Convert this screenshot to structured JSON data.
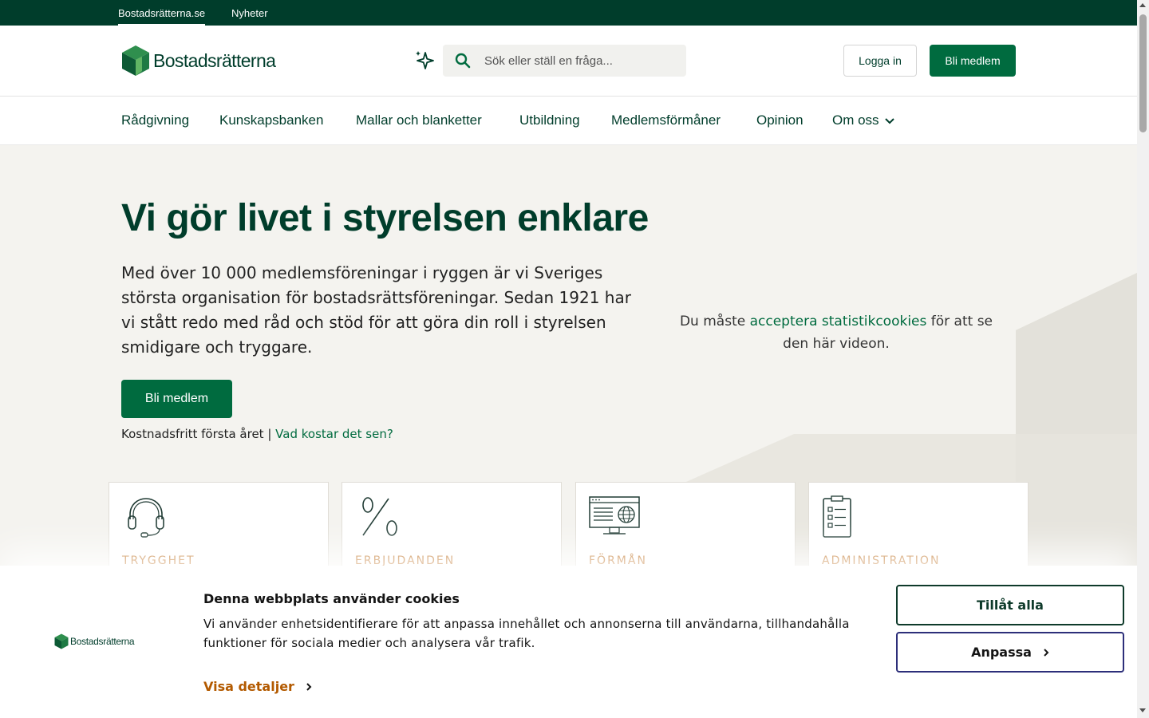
{
  "topbar": {
    "tabs": [
      {
        "label": "Bostadsrätterna.se"
      },
      {
        "label": "Nyheter"
      }
    ]
  },
  "header": {
    "logo_text": "Bostadsrätterna",
    "search_placeholder": "Sök eller ställ en fråga...",
    "login_label": "Logga in",
    "member_label": "Bli medlem"
  },
  "nav": {
    "items": [
      {
        "label": "Rådgivning"
      },
      {
        "label": "Kunskapsbanken"
      },
      {
        "label": "Mallar och blanketter"
      },
      {
        "label": "Utbildning"
      },
      {
        "label": "Medlemsförmåner"
      },
      {
        "label": "Opinion"
      },
      {
        "label": "Om oss"
      }
    ]
  },
  "hero": {
    "title": "Vi gör livet i styrelsen enklare",
    "lead": "Med över 10 000 medlemsföreningar i ryggen är vi Sveriges största organisation för bostadsrättsföreningar. Sedan 1921 har vi stått redo med råd och stöd för att göra din roll i styrelsen smidigare och tryggare.",
    "cta_label": "Bli medlem",
    "sub_text": "Kostnadsfritt första året |",
    "sub_link": "Vad kostar det sen?",
    "video_before": "Du måste",
    "video_link": "acceptera statistikcookies",
    "video_after": "för att se den här videon."
  },
  "cards": [
    {
      "label": "TRYGGHET",
      "icon": "headset-icon"
    },
    {
      "label": "ERBJUDANDEN",
      "icon": "percent-icon"
    },
    {
      "label": "FÖRMÅN",
      "icon": "web-monitor-icon"
    },
    {
      "label": "ADMINISTRATION",
      "icon": "clipboard-icon"
    }
  ],
  "cookie": {
    "logo_text": "Bostadsrätterna",
    "title": "Denna webbplats använder cookies",
    "body": "Vi använder enhetsidentifierare för att anpassa innehållet och annonserna till användarna, tillhandahålla funktioner för sociala medier och analysera vår trafik.",
    "details_label": "Visa detaljer",
    "allow_label": "Tillåt alla",
    "adapt_label": "Anpassa"
  },
  "colors": {
    "brand_dark": "#003d2b",
    "brand_green": "#006b3f",
    "hero_bg": "#f4f3ef",
    "card_label": "#b35a00"
  }
}
